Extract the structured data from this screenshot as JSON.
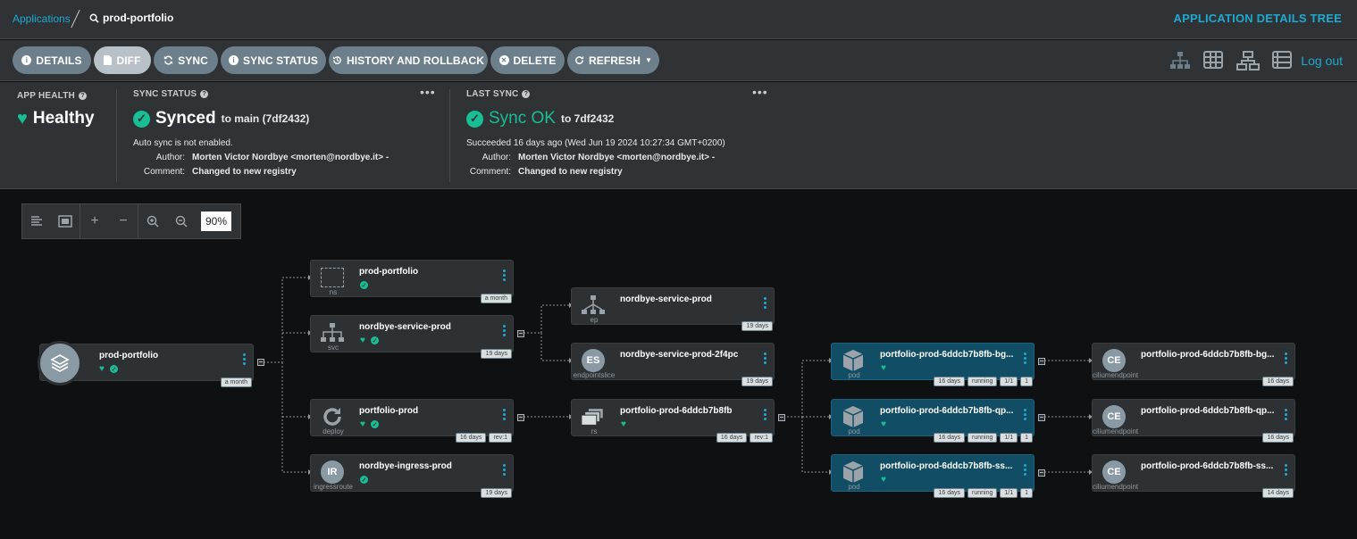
{
  "breadcrumb": {
    "app_link": "Applications",
    "current": "prod-portfolio"
  },
  "view_title": "APPLICATION DETAILS TREE",
  "toolbar": {
    "details": "DETAILS",
    "diff": "DIFF",
    "sync": "SYNC",
    "sync_status": "SYNC STATUS",
    "history": "HISTORY AND ROLLBACK",
    "delete": "DELETE",
    "refresh": "REFRESH",
    "logout": "Log out"
  },
  "app_health": {
    "title": "APP HEALTH",
    "value": "Healthy"
  },
  "sync_status": {
    "title": "SYNC STATUS",
    "value": "Synced",
    "target": "to main (7df2432)",
    "auto": "Auto sync is not enabled.",
    "author_label": "Author:",
    "author": "Morten Victor Nordbye <morten@nordbye.it> -",
    "comment_label": "Comment:",
    "comment": "Changed to new registry"
  },
  "last_sync": {
    "title": "LAST SYNC",
    "value": "Sync OK",
    "target": "to 7df2432",
    "succeeded": "Succeeded 16 days ago (Wed Jun 19 2024 10:27:34 GMT+0200)",
    "author_label": "Author:",
    "author": "Morten Victor Nordbye <morten@nordbye.it> -",
    "comment_label": "Comment:",
    "comment": "Changed to new registry"
  },
  "zoom": "90%",
  "colors": {
    "accent": "#1fa9d1",
    "healthy": "#18be94",
    "panel": "#2f3336",
    "pod": "#114e66"
  },
  "nodes": {
    "app": {
      "name": "prod-portfolio",
      "tags": [
        "a month"
      ]
    },
    "ns": {
      "name": "prod-portfolio",
      "kind": "ns",
      "tags": [
        "a month"
      ]
    },
    "svc": {
      "name": "nordbye-service-prod",
      "kind": "svc",
      "tags": [
        "19 days"
      ]
    },
    "deploy": {
      "name": "portfolio-prod",
      "kind": "deploy",
      "tags": [
        "16 days",
        "rev:1"
      ]
    },
    "ingress": {
      "name": "nordbye-ingress-prod",
      "kind": "ingressroute",
      "abbr": "IR",
      "tags": [
        "19 days"
      ]
    },
    "ep": {
      "name": "nordbye-service-prod",
      "kind": "ep",
      "tags": [
        "19 days"
      ]
    },
    "es": {
      "name": "nordbye-service-prod-2f4pc",
      "kind": "endpointslice",
      "abbr": "ES",
      "tags": [
        "19 days"
      ]
    },
    "rs": {
      "name": "portfolio-prod-6ddcb7b8fb",
      "kind": "rs",
      "tags": [
        "16 days",
        "rev:1"
      ]
    },
    "pod1": {
      "name": "portfolio-prod-6ddcb7b8fb-bg...",
      "kind": "pod",
      "tags": [
        "16 days",
        "running",
        "1/1",
        "1"
      ]
    },
    "pod2": {
      "name": "portfolio-prod-6ddcb7b8fb-qp...",
      "kind": "pod",
      "tags": [
        "16 days",
        "running",
        "1/1",
        "1"
      ]
    },
    "pod3": {
      "name": "portfolio-prod-6ddcb7b8fb-ss...",
      "kind": "pod",
      "tags": [
        "16 days",
        "running",
        "1/1",
        "1"
      ]
    },
    "ce1": {
      "name": "portfolio-prod-6ddcb7b8fb-bg...",
      "kind": "ciliumendpoint",
      "abbr": "CE",
      "tags": [
        "16 days"
      ]
    },
    "ce2": {
      "name": "portfolio-prod-6ddcb7b8fb-qp...",
      "kind": "ciliumendpoint",
      "abbr": "CE",
      "tags": [
        "16 days"
      ]
    },
    "ce3": {
      "name": "portfolio-prod-6ddcb7b8fb-ss...",
      "kind": "ciliumendpoint",
      "abbr": "CE",
      "tags": [
        "14 days"
      ]
    }
  }
}
